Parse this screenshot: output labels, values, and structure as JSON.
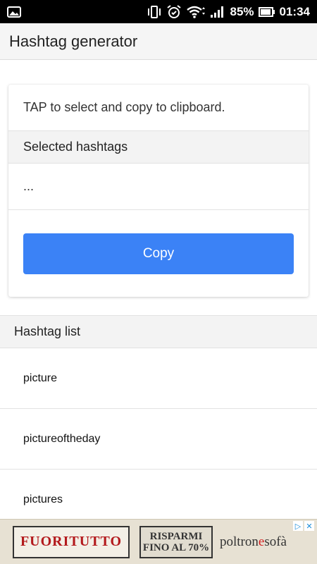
{
  "status_bar": {
    "battery_percent": "85%",
    "time": "01:34",
    "icons": [
      "gallery-notification-icon",
      "vibrate-icon",
      "alarm-icon",
      "wifi-icon",
      "signal-icon",
      "battery-icon"
    ]
  },
  "app_bar": {
    "title": "Hashtag generator"
  },
  "card": {
    "hint": "TAP to select and copy to clipboard.",
    "selected_header": "Selected hashtags",
    "selected_value": "...",
    "copy_label": "Copy"
  },
  "list": {
    "header": "Hashtag list",
    "items": [
      "picture",
      "pictureoftheday",
      "pictures"
    ]
  },
  "ad": {
    "box1": "FUORITUTTO",
    "box2_line1": "RISPARMI",
    "box2_line2": "FINO AL 70%",
    "brand_part1": "poltron",
    "brand_accent": "e",
    "brand_part2": "sofà"
  },
  "colors": {
    "accent": "#3b82f6",
    "status_bar": "#000000",
    "app_bar": "#f5f5f5"
  }
}
